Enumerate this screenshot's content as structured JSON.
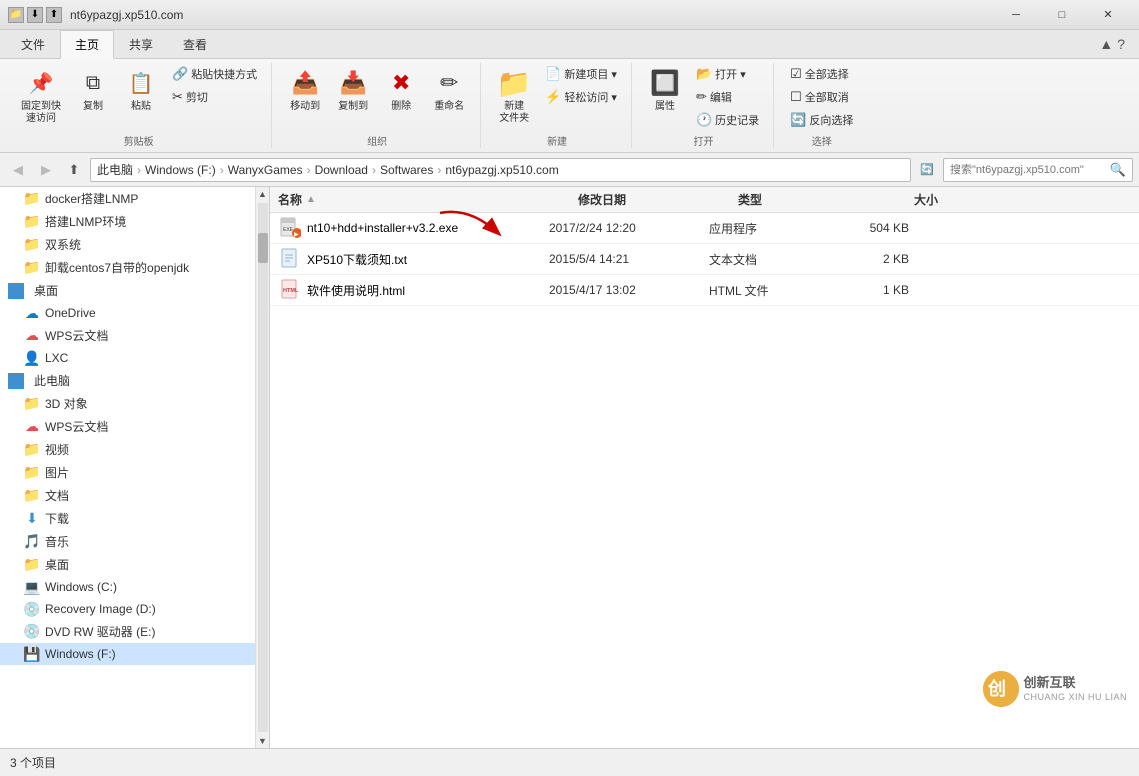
{
  "title_bar": {
    "quick_icons": [
      "📁",
      "⬇",
      "⬆"
    ],
    "title": "nt6ypazgj.xp510.com",
    "controls": {
      "minimize": "─",
      "maximize": "□",
      "close": "✕"
    }
  },
  "ribbon": {
    "tabs": [
      "文件",
      "主页",
      "共享",
      "查看"
    ],
    "active_tab": "主页",
    "groups": {
      "clipboard": {
        "label": "剪贴板",
        "buttons": [
          {
            "label": "固定到快\n速访问",
            "icon": "📌"
          },
          {
            "label": "复制",
            "icon": "⧉"
          },
          {
            "label": "粘贴",
            "icon": "📋"
          },
          {
            "label": "粘贴快捷方式",
            "icon": "📋🔗"
          },
          {
            "label": "✂剪切",
            "icon": "✂"
          }
        ]
      },
      "organize": {
        "label": "组织",
        "buttons": [
          {
            "label": "移动到",
            "icon": "📤"
          },
          {
            "label": "复制到",
            "icon": "📥"
          },
          {
            "label": "删除",
            "icon": "✖"
          },
          {
            "label": "重命名",
            "icon": "✏"
          }
        ]
      },
      "new": {
        "label": "新建",
        "buttons": [
          {
            "label": "新建\n文件夹",
            "icon": "📁"
          },
          {
            "label": "新建项目▾",
            "icon": "📄"
          },
          {
            "label": "轻松访问▾",
            "icon": "⚡"
          }
        ]
      },
      "open": {
        "label": "打开",
        "buttons": [
          {
            "label": "属性",
            "icon": "ℹ"
          },
          {
            "label": "打开▾",
            "icon": "📂"
          },
          {
            "label": "编辑",
            "icon": "✏"
          },
          {
            "label": "历史记录",
            "icon": "🕐"
          }
        ]
      },
      "select": {
        "label": "选择",
        "buttons": [
          {
            "label": "全部选择",
            "icon": "☑"
          },
          {
            "label": "全部取消",
            "icon": "☐"
          },
          {
            "label": "反向选择",
            "icon": "🔄"
          }
        ]
      }
    }
  },
  "address_bar": {
    "back_enabled": false,
    "forward_enabled": false,
    "up_enabled": true,
    "breadcrumbs": [
      "此电脑",
      "Windows (F:)",
      "WanyxGames",
      "Download",
      "Softwares",
      "nt6ypazgj.xp510.com"
    ],
    "search_placeholder": "搜索\"nt6ypazgj.xp510.com\"",
    "search_icon": "🔍"
  },
  "sidebar": {
    "items": [
      {
        "label": "docker搭建LNMP",
        "icon": "📁",
        "indent": 1,
        "type": "folder"
      },
      {
        "label": "搭建LNMP环境",
        "icon": "📁",
        "indent": 1,
        "type": "folder"
      },
      {
        "label": "双系统",
        "icon": "📁",
        "indent": 1,
        "type": "folder"
      },
      {
        "label": "卸载centos7自带的openjdk",
        "icon": "📁",
        "indent": 1,
        "type": "folder"
      },
      {
        "label": "桌面",
        "icon": "🖥",
        "indent": 0,
        "type": "folder-blue"
      },
      {
        "label": "OneDrive",
        "icon": "☁",
        "indent": 1,
        "type": "cloud"
      },
      {
        "label": "WPS云文档",
        "icon": "☁",
        "indent": 1,
        "type": "cloud"
      },
      {
        "label": "LXC",
        "icon": "👤",
        "indent": 1,
        "type": "user"
      },
      {
        "label": "此电脑",
        "icon": "🖥",
        "indent": 0,
        "type": "computer"
      },
      {
        "label": "3D 对象",
        "icon": "🎲",
        "indent": 1,
        "type": "folder"
      },
      {
        "label": "WPS云文档",
        "icon": "☁",
        "indent": 1,
        "type": "cloud"
      },
      {
        "label": "视频",
        "icon": "🎬",
        "indent": 1,
        "type": "folder"
      },
      {
        "label": "图片",
        "icon": "🖼",
        "indent": 1,
        "type": "folder"
      },
      {
        "label": "文档",
        "icon": "📄",
        "indent": 1,
        "type": "folder"
      },
      {
        "label": "下载",
        "icon": "⬇",
        "indent": 1,
        "type": "folder"
      },
      {
        "label": "音乐",
        "icon": "🎵",
        "indent": 1,
        "type": "folder"
      },
      {
        "label": "桌面",
        "icon": "🖥",
        "indent": 1,
        "type": "folder"
      },
      {
        "label": "Windows (C:)",
        "icon": "💻",
        "indent": 1,
        "type": "drive"
      },
      {
        "label": "Recovery Image (D:)",
        "icon": "💿",
        "indent": 1,
        "type": "drive"
      },
      {
        "label": "DVD RW 驱动器 (E:)",
        "icon": "💿",
        "indent": 1,
        "type": "drive"
      },
      {
        "label": "Windows (F:)",
        "icon": "💾",
        "indent": 1,
        "type": "drive",
        "selected": true
      }
    ]
  },
  "file_list": {
    "headers": [
      {
        "label": "名称",
        "sort": "asc"
      },
      {
        "label": "修改日期"
      },
      {
        "label": "类型"
      },
      {
        "label": "大小"
      }
    ],
    "files": [
      {
        "name": "nt10+hdd+installer+v3.2.exe",
        "icon": "exe",
        "date": "2017/2/24 12:20",
        "type": "应用程序",
        "size": "504 KB"
      },
      {
        "name": "XP510下载须知.txt",
        "icon": "txt",
        "date": "2015/5/4 14:21",
        "type": "文本文档",
        "size": "2 KB"
      },
      {
        "name": "软件使用说明.html",
        "icon": "html",
        "date": "2015/4/17 13:02",
        "type": "HTML 文件",
        "size": "1 KB"
      }
    ]
  },
  "status_bar": {
    "item_count": "3 个项目"
  },
  "watermark": {
    "text_line1": "创新互联",
    "text_line2": "CHUANG XIN HU LIAN"
  }
}
